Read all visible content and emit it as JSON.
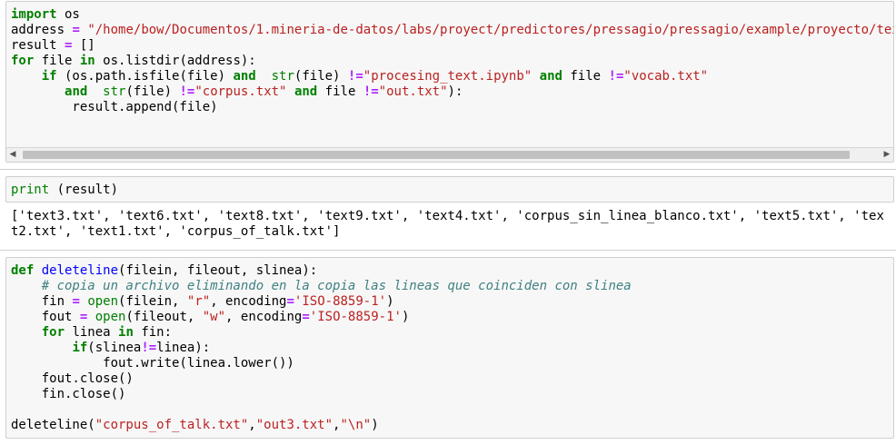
{
  "cell1": {
    "lines": [
      [
        {
          "t": "import",
          "c": "kw"
        },
        {
          "t": " os"
        }
      ],
      [
        {
          "t": "address "
        },
        {
          "t": "=",
          "c": "op"
        },
        {
          "t": " "
        },
        {
          "t": "\"/home/bow/Documentos/1.mineria-de-datos/labs/proyect/predictores/pressagio/pressagio/example/proyecto/tex",
          "c": "str"
        }
      ],
      [
        {
          "t": "result "
        },
        {
          "t": "=",
          "c": "op"
        },
        {
          "t": " []"
        }
      ],
      [
        {
          "t": "for",
          "c": "kw"
        },
        {
          "t": " file "
        },
        {
          "t": "in",
          "c": "kw"
        },
        {
          "t": " os.listdir(address):"
        }
      ],
      [
        {
          "t": "    "
        },
        {
          "t": "if",
          "c": "kw"
        },
        {
          "t": " (os.path.isfile(file) "
        },
        {
          "t": "and",
          "c": "kw"
        },
        {
          "t": "  "
        },
        {
          "t": "str",
          "c": "bi"
        },
        {
          "t": "(file) "
        },
        {
          "t": "!=",
          "c": "op"
        },
        {
          "t": "\"procesing_text.ipynb\"",
          "c": "str"
        },
        {
          "t": " "
        },
        {
          "t": "and",
          "c": "kw"
        },
        {
          "t": " file "
        },
        {
          "t": "!=",
          "c": "op"
        },
        {
          "t": "\"vocab.txt\"",
          "c": "str"
        }
      ],
      [
        {
          "t": "       "
        },
        {
          "t": "and",
          "c": "kw"
        },
        {
          "t": "  "
        },
        {
          "t": "str",
          "c": "bi"
        },
        {
          "t": "(file) "
        },
        {
          "t": "!=",
          "c": "op"
        },
        {
          "t": "\"corpus.txt\"",
          "c": "str"
        },
        {
          "t": " "
        },
        {
          "t": "and",
          "c": "kw"
        },
        {
          "t": " file "
        },
        {
          "t": "!=",
          "c": "op"
        },
        {
          "t": "\"out.txt\"",
          "c": "str"
        },
        {
          "t": "):"
        }
      ],
      [
        {
          "t": "        result.append(file)"
        }
      ]
    ]
  },
  "cell2": {
    "lines": [
      [
        {
          "t": "print",
          "c": "bi"
        },
        {
          "t": " (result)"
        }
      ]
    ],
    "output": [
      "['text3.txt', 'text6.txt', 'text8.txt', 'text9.txt', 'text4.txt', 'corpus_sin_linea_blanco.txt', 'text5.txt', 'tex",
      "t2.txt', 'text1.txt', 'corpus_of_talk.txt']"
    ]
  },
  "cell3": {
    "lines": [
      [
        {
          "t": "def",
          "c": "kw"
        },
        {
          "t": " "
        },
        {
          "t": "deleteline",
          "c": "fn"
        },
        {
          "t": "(filein, fileout, slinea):"
        }
      ],
      [
        {
          "t": "    "
        },
        {
          "t": "# copia un archivo eliminando en la copia las lineas que coinciden con slinea",
          "c": "cm"
        }
      ],
      [
        {
          "t": "    fin "
        },
        {
          "t": "=",
          "c": "op"
        },
        {
          "t": " "
        },
        {
          "t": "open",
          "c": "bi"
        },
        {
          "t": "(filein, "
        },
        {
          "t": "\"r\"",
          "c": "str"
        },
        {
          "t": ", encoding"
        },
        {
          "t": "=",
          "c": "op"
        },
        {
          "t": "'ISO-8859-1'",
          "c": "str"
        },
        {
          "t": ")"
        }
      ],
      [
        {
          "t": "    fout "
        },
        {
          "t": "=",
          "c": "op"
        },
        {
          "t": " "
        },
        {
          "t": "open",
          "c": "bi"
        },
        {
          "t": "(fileout, "
        },
        {
          "t": "\"w\"",
          "c": "str"
        },
        {
          "t": ", encoding"
        },
        {
          "t": "=",
          "c": "op"
        },
        {
          "t": "'ISO-8859-1'",
          "c": "str"
        },
        {
          "t": ")"
        }
      ],
      [
        {
          "t": "    "
        },
        {
          "t": "for",
          "c": "kw"
        },
        {
          "t": " linea "
        },
        {
          "t": "in",
          "c": "kw"
        },
        {
          "t": " fin:"
        }
      ],
      [
        {
          "t": "        "
        },
        {
          "t": "if",
          "c": "kw"
        },
        {
          "t": "(slinea"
        },
        {
          "t": "!=",
          "c": "op"
        },
        {
          "t": "linea):"
        }
      ],
      [
        {
          "t": "            fout.write(linea.lower())"
        }
      ],
      [
        {
          "t": "    fout.close()"
        }
      ],
      [
        {
          "t": "    fin.close()"
        }
      ],
      [
        {
          "t": ""
        }
      ],
      [
        {
          "t": "deleteline("
        },
        {
          "t": "\"corpus_of_talk.txt\"",
          "c": "str"
        },
        {
          "t": ","
        },
        {
          "t": "\"out3.txt\"",
          "c": "str"
        },
        {
          "t": ","
        },
        {
          "t": "\"\\n\"",
          "c": "str"
        },
        {
          "t": ")"
        }
      ]
    ]
  },
  "scrollbar": {
    "left_arrow": "◀",
    "right_arrow": "▶"
  }
}
